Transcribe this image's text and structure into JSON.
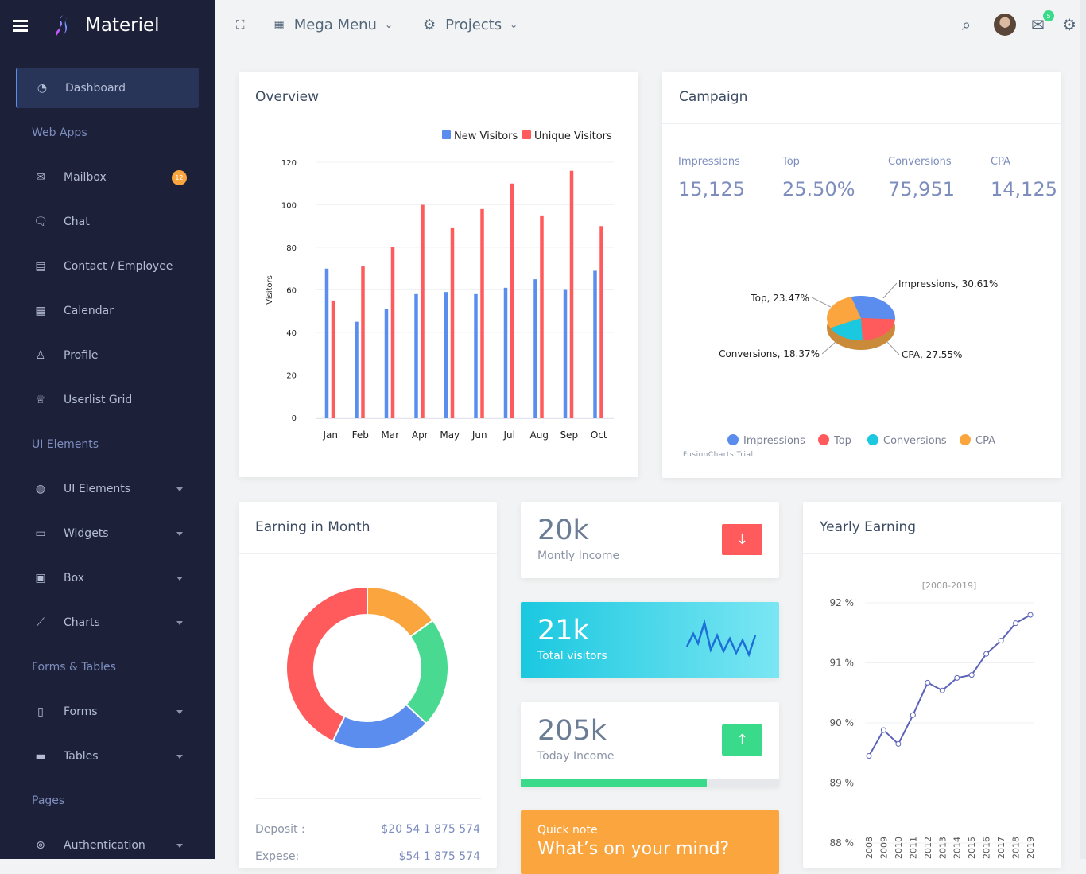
{
  "brand": {
    "name": "Materiel"
  },
  "sidebar": {
    "active": {
      "label": "Dashboard",
      "icon": "gauge-icon"
    },
    "sections": [
      {
        "heading": "Web Apps",
        "items": [
          {
            "label": "Mailbox",
            "icon": "mail-icon",
            "badge": "12"
          },
          {
            "label": "Chat",
            "icon": "chat-icon"
          },
          {
            "label": "Contact / Employee",
            "icon": "contact-card-icon"
          },
          {
            "label": "Calendar",
            "icon": "calendar-icon"
          },
          {
            "label": "Profile",
            "icon": "user-icon"
          },
          {
            "label": "Userlist Grid",
            "icon": "trophy-icon"
          }
        ]
      },
      {
        "heading": "UI Elements",
        "items": [
          {
            "label": "UI Elements",
            "icon": "palette-icon",
            "caret": true
          },
          {
            "label": "Widgets",
            "icon": "widget-icon",
            "caret": true
          },
          {
            "label": "Box",
            "icon": "box-icon",
            "caret": true
          },
          {
            "label": "Charts",
            "icon": "chart-line-icon",
            "caret": true
          }
        ]
      },
      {
        "heading": "Forms & Tables",
        "items": [
          {
            "label": "Forms",
            "icon": "clipboard-icon",
            "caret": true
          },
          {
            "label": "Tables",
            "icon": "table-icon",
            "caret": true
          }
        ]
      },
      {
        "heading": "Pages",
        "items": [
          {
            "label": "Authentication",
            "icon": "broadcast-icon",
            "caret": true
          }
        ]
      }
    ]
  },
  "topbar": {
    "mega_menu": "Mega Menu",
    "projects": "Projects",
    "mail_badge": "5"
  },
  "overview": {
    "title": "Overview",
    "chart_data": {
      "type": "bar",
      "categories": [
        "Jan",
        "Feb",
        "Mar",
        "Apr",
        "May",
        "Jun",
        "Jul",
        "Aug",
        "Sep",
        "Oct"
      ],
      "series": [
        {
          "name": "New Visitors",
          "color": "#5b8def",
          "values": [
            70,
            45,
            51,
            58,
            59,
            58,
            61,
            65,
            60,
            69
          ]
        },
        {
          "name": "Unique Visitors",
          "color": "#ff5b5c",
          "values": [
            55,
            71,
            80,
            100,
            89,
            98,
            110,
            95,
            116,
            90
          ]
        }
      ],
      "ylabel": "Visitors",
      "ylim": [
        0,
        120
      ],
      "yticks": [
        "0",
        "20",
        "40",
        "60",
        "80",
        "100",
        "120"
      ],
      "legend": "top-right",
      "grid": true
    }
  },
  "campaign": {
    "title": "Campaign",
    "stats": [
      {
        "label": "Impressions",
        "value": "15,125"
      },
      {
        "label": "Top",
        "value": "25.50%"
      },
      {
        "label": "Conversions",
        "value": "75,951"
      },
      {
        "label": "CPA",
        "value": "14,125"
      }
    ],
    "chart_data": {
      "type": "pie",
      "slices": [
        {
          "name": "Impressions",
          "value": 30.61,
          "label": "Impressions, 30.61%",
          "color": "#5b8def"
        },
        {
          "name": "Top",
          "value": 23.47,
          "label": "Top, 23.47%",
          "color": "#ff5b5c"
        },
        {
          "name": "Conversions",
          "value": 18.37,
          "label": "Conversions, 18.37%",
          "color": "#1ac8e0"
        },
        {
          "name": "CPA",
          "value": 27.55,
          "label": "CPA, 27.55%",
          "color": "#fba53f"
        }
      ],
      "legend": "bottom"
    },
    "watermark": "FusionCharts Trial"
  },
  "earning": {
    "title": "Earning in Month",
    "chart_data": {
      "type": "pie",
      "donut": true,
      "slices": [
        {
          "value": 15,
          "color": "#fba53f"
        },
        {
          "value": 22,
          "color": "#4ad991"
        },
        {
          "value": 20,
          "color": "#5b8def"
        },
        {
          "value": 43,
          "color": "#ff5b5c"
        }
      ]
    },
    "rows": [
      {
        "label": "Deposit :",
        "value": "$20 54 1 875 574"
      },
      {
        "label": "Expese:",
        "value": "$54 1 875 574"
      }
    ]
  },
  "widgets": {
    "monthly": {
      "value": "20k",
      "label": "Montly Income",
      "color": "#ff5b5c"
    },
    "visitors": {
      "value": "21k",
      "label": "Total visitors"
    },
    "today": {
      "value": "205k",
      "label": "Today Income",
      "color": "#39da8a",
      "progress": 72
    },
    "note": {
      "label": "Quick note",
      "text": "What’s on your mind?"
    }
  },
  "yearly": {
    "title": "Yearly Earning",
    "chart_data": {
      "type": "line",
      "subtitle": "[2008-2019]",
      "x": [
        "2008",
        "2009",
        "2010",
        "2011",
        "2012",
        "2013",
        "2014",
        "2015",
        "2016",
        "2017",
        "2018",
        "2019"
      ],
      "values": [
        89.45,
        89.88,
        89.65,
        90.13,
        90.67,
        90.54,
        90.75,
        90.8,
        91.15,
        91.37,
        91.66,
        91.8
      ],
      "ylim": [
        88,
        92
      ],
      "yticks": [
        "88 %",
        "89 %",
        "90 %",
        "91 %",
        "92 %"
      ],
      "color": "#5c63b8",
      "grid": true
    }
  }
}
